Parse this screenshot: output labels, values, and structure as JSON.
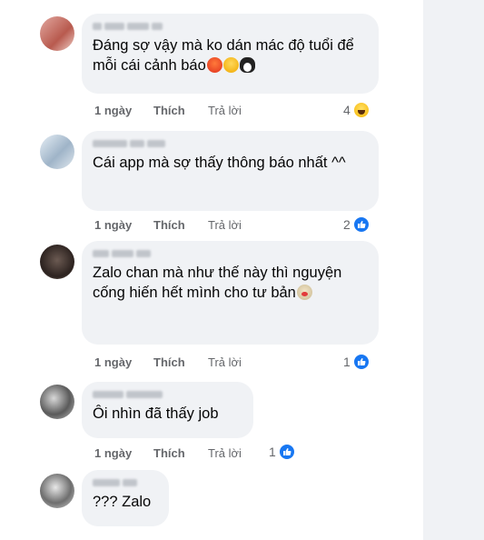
{
  "comments": [
    {
      "text": "Đáng sợ vậy mà ko dán mác độ tuổi để mỗi cái cảnh báo",
      "emojis": [
        "angry-face-icon",
        "hot-face-icon",
        "penguin-icon"
      ],
      "time": "1 ngày",
      "like_label": "Thích",
      "reply_label": "Trả lời",
      "reaction_count": "4",
      "reaction_icon": "haha-icon"
    },
    {
      "text": "Cái app mà sợ thấy thông báo nhất ^^",
      "time": "1 ngày",
      "like_label": "Thích",
      "reply_label": "Trả lời",
      "reaction_count": "2",
      "reaction_icon": "like-icon"
    },
    {
      "text": "Zalo chan mà như thế này thì nguyện cống hiến hết mình cho tư bản",
      "emojis": [
        "clown-face-icon"
      ],
      "time": "1 ngày",
      "like_label": "Thích",
      "reply_label": "Trả lời",
      "reaction_count": "1",
      "reaction_icon": "like-icon"
    },
    {
      "text": "Ôi nhìn đã thấy job",
      "time": "1 ngày",
      "like_label": "Thích",
      "reply_label": "Trả lời",
      "reaction_count": "1",
      "reaction_icon": "like-icon"
    },
    {
      "text": "??? Zalo"
    }
  ],
  "colors": {
    "bubble": "#f0f2f5",
    "like_blue": "#1877f2",
    "meta_gray": "#65676b"
  }
}
